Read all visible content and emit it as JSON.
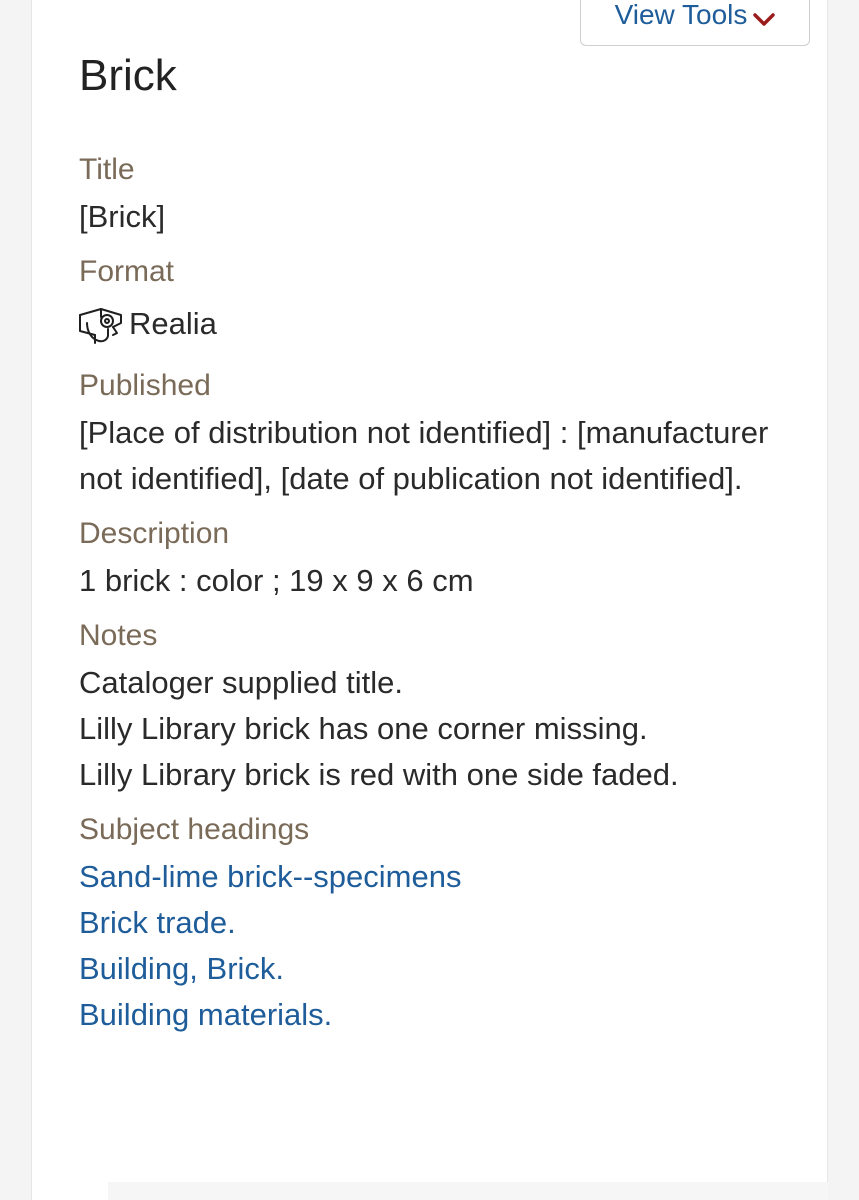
{
  "toolbar": {
    "view_tools_label": "View Tools"
  },
  "record": {
    "heading": "Brick",
    "fields": {
      "title_label": "Title",
      "title_value": "[Brick]",
      "format_label": "Format",
      "format_value": "Realia",
      "format_icon": "realia-icon",
      "published_label": "Published",
      "published_value": "[Place of distribution not identified] : [manufacturer not identified], [date of publication not identified].",
      "description_label": "Description",
      "description_value": "1 brick : color ; 19 x 9 x 6 cm",
      "notes_label": "Notes",
      "notes": [
        "Cataloger supplied title.",
        "Lilly Library brick has one corner missing.",
        "Lilly Library brick is red with one side faded."
      ],
      "subjects_label": "Subject headings",
      "subjects": [
        "Sand-lime brick--specimens",
        "Brick trade.",
        "Building, Brick.",
        "Building materials."
      ]
    }
  },
  "colors": {
    "label": "#7a6a58",
    "link": "#1e5d9a",
    "chevron": "#9b1c1c"
  }
}
